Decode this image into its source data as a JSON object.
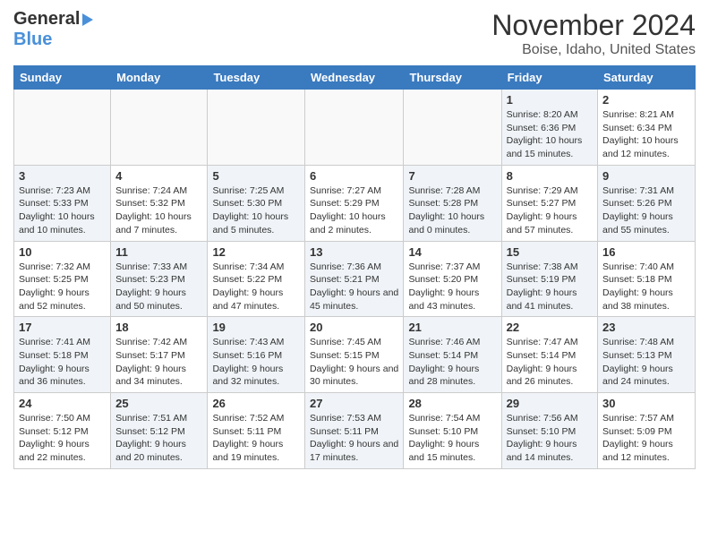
{
  "header": {
    "logo_line1": "General",
    "logo_line2": "Blue",
    "month_year": "November 2024",
    "location": "Boise, Idaho, United States"
  },
  "weekdays": [
    "Sunday",
    "Monday",
    "Tuesday",
    "Wednesday",
    "Thursday",
    "Friday",
    "Saturday"
  ],
  "weeks": [
    [
      {
        "num": "",
        "info": ""
      },
      {
        "num": "",
        "info": ""
      },
      {
        "num": "",
        "info": ""
      },
      {
        "num": "",
        "info": ""
      },
      {
        "num": "",
        "info": ""
      },
      {
        "num": "1",
        "info": "Sunrise: 8:20 AM\nSunset: 6:36 PM\nDaylight: 10 hours and 15 minutes."
      },
      {
        "num": "2",
        "info": "Sunrise: 8:21 AM\nSunset: 6:34 PM\nDaylight: 10 hours and 12 minutes."
      }
    ],
    [
      {
        "num": "3",
        "info": "Sunrise: 7:23 AM\nSunset: 5:33 PM\nDaylight: 10 hours and 10 minutes."
      },
      {
        "num": "4",
        "info": "Sunrise: 7:24 AM\nSunset: 5:32 PM\nDaylight: 10 hours and 7 minutes."
      },
      {
        "num": "5",
        "info": "Sunrise: 7:25 AM\nSunset: 5:30 PM\nDaylight: 10 hours and 5 minutes."
      },
      {
        "num": "6",
        "info": "Sunrise: 7:27 AM\nSunset: 5:29 PM\nDaylight: 10 hours and 2 minutes."
      },
      {
        "num": "7",
        "info": "Sunrise: 7:28 AM\nSunset: 5:28 PM\nDaylight: 10 hours and 0 minutes."
      },
      {
        "num": "8",
        "info": "Sunrise: 7:29 AM\nSunset: 5:27 PM\nDaylight: 9 hours and 57 minutes."
      },
      {
        "num": "9",
        "info": "Sunrise: 7:31 AM\nSunset: 5:26 PM\nDaylight: 9 hours and 55 minutes."
      }
    ],
    [
      {
        "num": "10",
        "info": "Sunrise: 7:32 AM\nSunset: 5:25 PM\nDaylight: 9 hours and 52 minutes."
      },
      {
        "num": "11",
        "info": "Sunrise: 7:33 AM\nSunset: 5:23 PM\nDaylight: 9 hours and 50 minutes."
      },
      {
        "num": "12",
        "info": "Sunrise: 7:34 AM\nSunset: 5:22 PM\nDaylight: 9 hours and 47 minutes."
      },
      {
        "num": "13",
        "info": "Sunrise: 7:36 AM\nSunset: 5:21 PM\nDaylight: 9 hours and 45 minutes."
      },
      {
        "num": "14",
        "info": "Sunrise: 7:37 AM\nSunset: 5:20 PM\nDaylight: 9 hours and 43 minutes."
      },
      {
        "num": "15",
        "info": "Sunrise: 7:38 AM\nSunset: 5:19 PM\nDaylight: 9 hours and 41 minutes."
      },
      {
        "num": "16",
        "info": "Sunrise: 7:40 AM\nSunset: 5:18 PM\nDaylight: 9 hours and 38 minutes."
      }
    ],
    [
      {
        "num": "17",
        "info": "Sunrise: 7:41 AM\nSunset: 5:18 PM\nDaylight: 9 hours and 36 minutes."
      },
      {
        "num": "18",
        "info": "Sunrise: 7:42 AM\nSunset: 5:17 PM\nDaylight: 9 hours and 34 minutes."
      },
      {
        "num": "19",
        "info": "Sunrise: 7:43 AM\nSunset: 5:16 PM\nDaylight: 9 hours and 32 minutes."
      },
      {
        "num": "20",
        "info": "Sunrise: 7:45 AM\nSunset: 5:15 PM\nDaylight: 9 hours and 30 minutes."
      },
      {
        "num": "21",
        "info": "Sunrise: 7:46 AM\nSunset: 5:14 PM\nDaylight: 9 hours and 28 minutes."
      },
      {
        "num": "22",
        "info": "Sunrise: 7:47 AM\nSunset: 5:14 PM\nDaylight: 9 hours and 26 minutes."
      },
      {
        "num": "23",
        "info": "Sunrise: 7:48 AM\nSunset: 5:13 PM\nDaylight: 9 hours and 24 minutes."
      }
    ],
    [
      {
        "num": "24",
        "info": "Sunrise: 7:50 AM\nSunset: 5:12 PM\nDaylight: 9 hours and 22 minutes."
      },
      {
        "num": "25",
        "info": "Sunrise: 7:51 AM\nSunset: 5:12 PM\nDaylight: 9 hours and 20 minutes."
      },
      {
        "num": "26",
        "info": "Sunrise: 7:52 AM\nSunset: 5:11 PM\nDaylight: 9 hours and 19 minutes."
      },
      {
        "num": "27",
        "info": "Sunrise: 7:53 AM\nSunset: 5:11 PM\nDaylight: 9 hours and 17 minutes."
      },
      {
        "num": "28",
        "info": "Sunrise: 7:54 AM\nSunset: 5:10 PM\nDaylight: 9 hours and 15 minutes."
      },
      {
        "num": "29",
        "info": "Sunrise: 7:56 AM\nSunset: 5:10 PM\nDaylight: 9 hours and 14 minutes."
      },
      {
        "num": "30",
        "info": "Sunrise: 7:57 AM\nSunset: 5:09 PM\nDaylight: 9 hours and 12 minutes."
      }
    ]
  ]
}
